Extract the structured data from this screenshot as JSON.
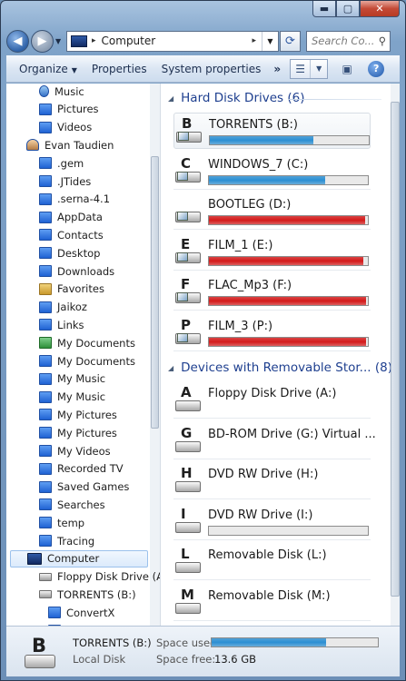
{
  "window": {
    "min_label": "▬",
    "max_label": "▢",
    "close_label": "✕"
  },
  "address": {
    "path": "Computer",
    "sep_before": "▸",
    "sep_after": "▸",
    "refresh_icon": "refresh-icon"
  },
  "search": {
    "placeholder": "Search Co...",
    "icon": "search-icon"
  },
  "toolbar": {
    "organize": "Organize",
    "properties": "Properties",
    "system_properties": "System properties",
    "more": "»"
  },
  "nav_tree": [
    {
      "label": "Music",
      "icon": "music"
    },
    {
      "label": "Pictures",
      "icon": "folder"
    },
    {
      "label": "Videos",
      "icon": "folder"
    },
    {
      "label": "Evan Taudien",
      "icon": "user"
    },
    {
      "label": ".gem",
      "icon": "folder"
    },
    {
      "label": ".JTides",
      "icon": "folder"
    },
    {
      "label": ".serna-4.1",
      "icon": "folder"
    },
    {
      "label": "AppData",
      "icon": "folder"
    },
    {
      "label": "Contacts",
      "icon": "folder"
    },
    {
      "label": "Desktop",
      "icon": "folder"
    },
    {
      "label": "Downloads",
      "icon": "folder"
    },
    {
      "label": "Favorites",
      "icon": "special"
    },
    {
      "label": "Jaikoz",
      "icon": "folder"
    },
    {
      "label": "Links",
      "icon": "folder"
    },
    {
      "label": "My Documents",
      "icon": "green"
    },
    {
      "label": "My Documents",
      "icon": "folder"
    },
    {
      "label": "My Music",
      "icon": "folder"
    },
    {
      "label": "My Music",
      "icon": "folder"
    },
    {
      "label": "My Pictures",
      "icon": "folder"
    },
    {
      "label": "My Pictures",
      "icon": "folder"
    },
    {
      "label": "My Videos",
      "icon": "folder"
    },
    {
      "label": "Recorded TV",
      "icon": "folder"
    },
    {
      "label": "Saved Games",
      "icon": "folder"
    },
    {
      "label": "Searches",
      "icon": "folder"
    },
    {
      "label": "temp",
      "icon": "folder"
    },
    {
      "label": "Tracing",
      "icon": "folder"
    },
    {
      "label": "Computer",
      "icon": "comp",
      "selected": true
    },
    {
      "label": "Floppy Disk Drive (A",
      "icon": "floppy"
    },
    {
      "label": "TORRENTS (B:)",
      "icon": "drive"
    },
    {
      "label": "ConvertX",
      "icon": "folder"
    },
    {
      "label": "_local",
      "icon": "folder"
    }
  ],
  "groups": {
    "hard_disks": "Hard Disk Drives (6)",
    "removable": "Devices with Removable Stor... (8)"
  },
  "hard_drives": [
    {
      "letter": "B",
      "name": "TORRENTS (B:)",
      "used": 0.65,
      "color": "#2b8fd3",
      "highlight": true
    },
    {
      "letter": "C",
      "name": "WINDOWS_7 (C:)",
      "used": 0.73,
      "color": "#2b8fd3"
    },
    {
      "letter": "",
      "name": "BOOTLEG (D:)",
      "used": 0.98,
      "color": "#d41a1a"
    },
    {
      "letter": "E",
      "name": "FILM_1 (E:)",
      "used": 0.97,
      "color": "#d41a1a"
    },
    {
      "letter": "F",
      "name": "FLAC_Mp3 (F:)",
      "used": 0.99,
      "color": "#d41a1a"
    },
    {
      "letter": "P",
      "name": "FILM_3 (P:)",
      "used": 0.99,
      "color": "#d41a1a"
    }
  ],
  "removable_drives": [
    {
      "letter": "A",
      "name": "Floppy Disk Drive (A:)"
    },
    {
      "letter": "G",
      "name": "BD-ROM Drive (G:) Virtual ..."
    },
    {
      "letter": "H",
      "name": "DVD RW Drive (H:)"
    },
    {
      "letter": "I",
      "name": "DVD RW Drive (I:)",
      "bar": true
    },
    {
      "letter": "L",
      "name": "Removable Disk (L:)"
    },
    {
      "letter": "M",
      "name": "Removable Disk (M:)"
    }
  ],
  "details": {
    "letter": "B",
    "name": "TORRENTS (B:)",
    "type": "Local Disk",
    "space_used_label": "Space used:",
    "space_free_label": "Space free:",
    "space_free": "13.6 GB",
    "used": 0.69,
    "color": "#2b8fd3"
  }
}
